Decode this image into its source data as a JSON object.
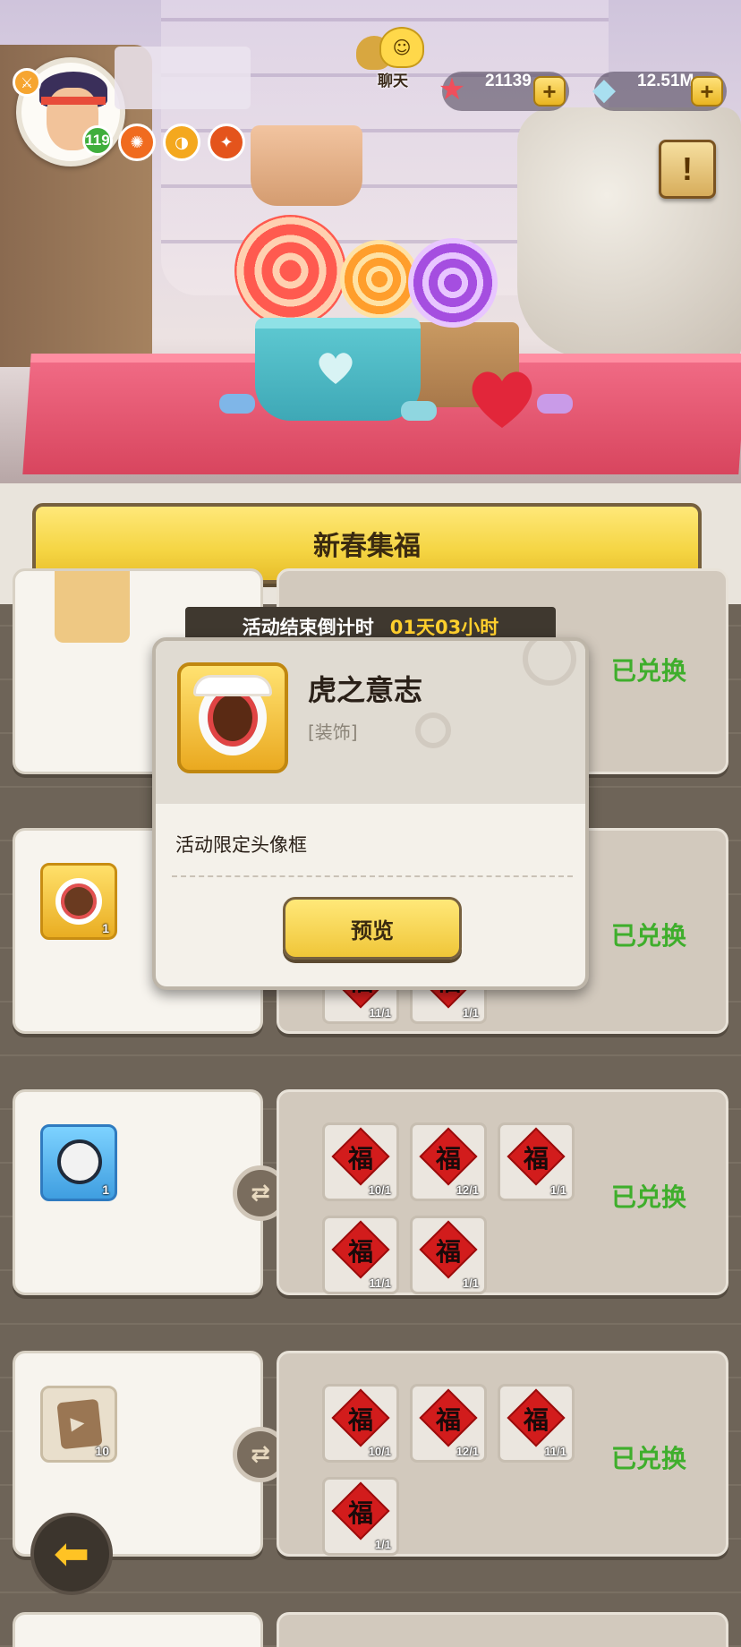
{
  "hud": {
    "level": "119",
    "chat_label": "聊天",
    "starfish_amount": "21139",
    "shell_amount": "12.51M",
    "plus_label": "+",
    "quest_label": "!"
  },
  "event": {
    "title": "新春集福",
    "countdown_label": "活动结束倒计时",
    "countdown_value": "01天03小时"
  },
  "rows": [
    {
      "reward_count": "1",
      "status": "已兑换",
      "cards": [
        {
          "char": "福",
          "qty": "11/1"
        },
        {
          "char": "福",
          "qty": "1/1"
        }
      ]
    },
    {
      "reward_count": "1",
      "status": "已兑换",
      "cards": [
        {
          "char": "福",
          "qty": "10/1"
        },
        {
          "char": "福",
          "qty": "12/1"
        },
        {
          "char": "福",
          "qty": "1/1"
        },
        {
          "char": "福",
          "qty": "11/1"
        },
        {
          "char": "福",
          "qty": "1/1"
        }
      ]
    },
    {
      "reward_count": "10",
      "status": "已兑换",
      "cards": [
        {
          "char": "福",
          "qty": "10/1"
        },
        {
          "char": "福",
          "qty": "12/1"
        },
        {
          "char": "福",
          "qty": "11/1"
        },
        {
          "char": "福",
          "qty": "1/1"
        }
      ]
    }
  ],
  "top_row_status": "已兑换",
  "popup": {
    "item_name": "虎之意志",
    "item_category": "[装饰]",
    "description": "活动限定头像框",
    "preview_label": "预览"
  },
  "colors": {
    "accent_yellow": "#f5d543",
    "exchanged_green": "#3fae2c",
    "countdown_time": "#ffcf2d"
  }
}
